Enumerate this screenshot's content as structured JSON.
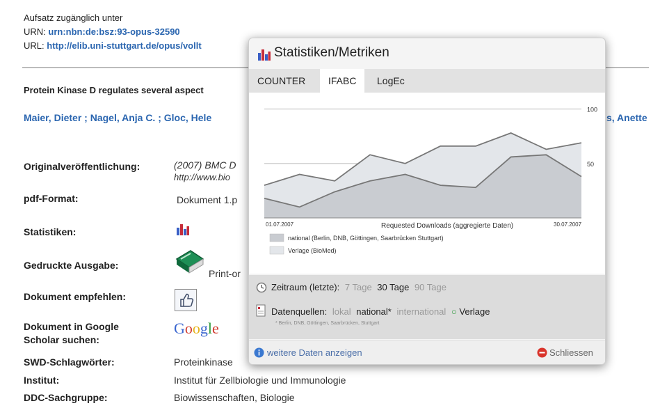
{
  "access": {
    "intro": "Aufsatz zugänglich unter",
    "urn_label": "URN:",
    "urn_value": "urn:nbn:de:bsz:93-opus-32590",
    "url_label": "URL:",
    "url_value": "http://elib.uni-stuttgart.de/opus/vollt"
  },
  "article": {
    "title": "Protein Kinase D regulates several aspect",
    "authors": "Maier, Dieter ; Nagel, Anja C. ; Gloc, Hele",
    "authors_tail": "s, Anette"
  },
  "rows": [
    {
      "label": "Originalveröffentlichung:",
      "value": "(2007) BMC D",
      "value2": "http://www.bio"
    },
    {
      "label": "pdf-Format:",
      "value": "Dokument 1.p"
    },
    {
      "label": "Statistiken:",
      "value": ""
    },
    {
      "label": "Gedruckte Ausgabe:",
      "value": "Print-or"
    },
    {
      "label": "Dokument empfehlen:",
      "value": ""
    },
    {
      "label": "Dokument in Google",
      "label2": "Scholar suchen:",
      "value": "Google"
    },
    {
      "label": "SWD-Schlagwörter:",
      "value": "Proteinkinase"
    },
    {
      "label": "Institut:",
      "value": "Institut für Zellbiologie und Immunologie"
    },
    {
      "label": "DDC-Sachgruppe:",
      "value": "Biowissenschaften, Biologie"
    }
  ],
  "popup": {
    "title": "Statistiken/Metriken",
    "tabs": [
      "COUNTER",
      "IFABC",
      "LogEc"
    ],
    "active_tab": "IFABC",
    "zeitraum_label": "Zeitraum (letzte):",
    "zeitraum_options": [
      "7 Tage",
      "30 Tage",
      "90 Tage"
    ],
    "zeitraum_selected": "30 Tage",
    "datenquellen_label": "Datenquellen:",
    "datenquellen_options": [
      "lokal",
      "national*",
      "international",
      "Verlage"
    ],
    "datenquellen_note": "* Berlin, DNB, Göttingen, Saarbrücken, Stuttgart",
    "more_link": "weitere Daten anzeigen",
    "close_label": "Schliessen"
  },
  "chart_data": {
    "type": "area",
    "xlabel": "Requested Downloads (aggregierte Daten)",
    "x_start_label": "01.07.2007",
    "x_end_label": "30.07.2007",
    "yticks": [
      50,
      100
    ],
    "ylim": [
      0,
      110
    ],
    "grid": true,
    "legend_position": "bottom-left",
    "series": [
      {
        "name": "national (Berlin, DNB, Göttingen, Saarbrücken Stuttgart)",
        "color": "#c9ccd1",
        "values": [
          18,
          10,
          24,
          34,
          40,
          30,
          28,
          56,
          58,
          38
        ]
      },
      {
        "name": "Verlage (BioMed)",
        "color": "#e3e6ea",
        "values": [
          30,
          40,
          34,
          58,
          50,
          66,
          66,
          78,
          63,
          69
        ]
      }
    ]
  }
}
